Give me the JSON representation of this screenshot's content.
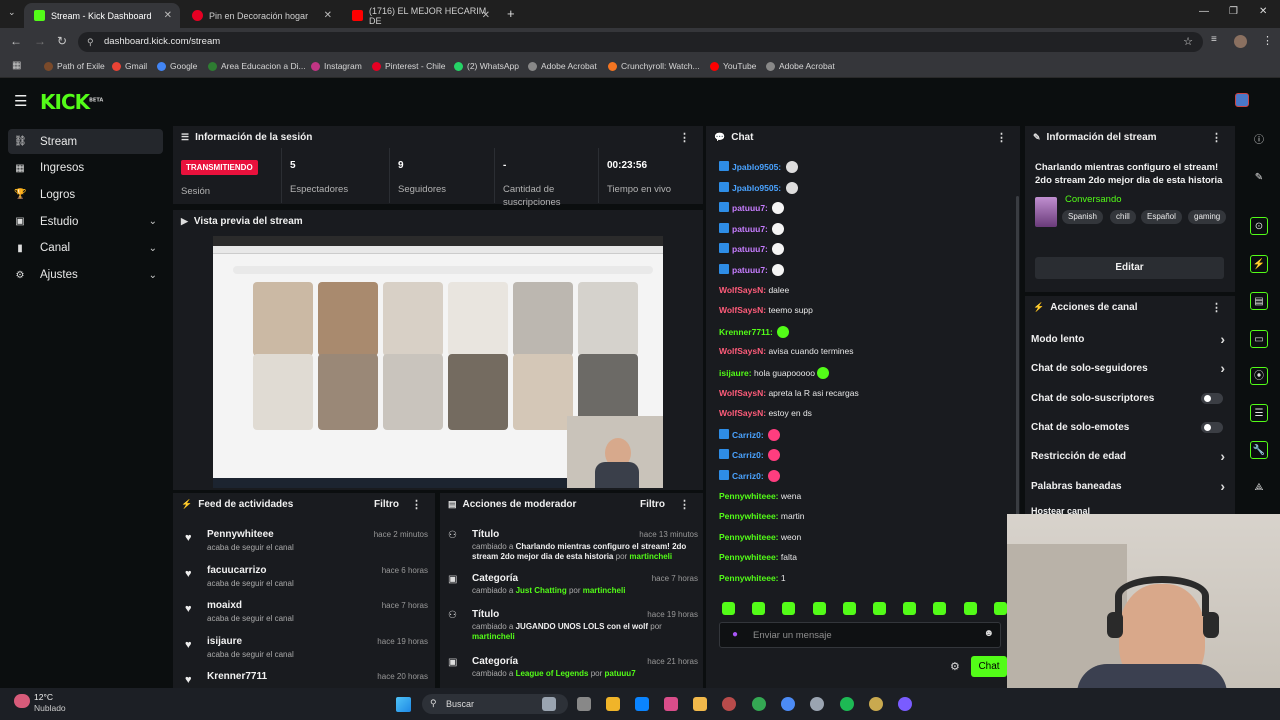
{
  "browser": {
    "tabs": [
      {
        "title": "Stream - Kick Dashboard",
        "color": "#53fc18"
      },
      {
        "title": "Pin en Decoración hogar",
        "color": "#e60023"
      },
      {
        "title": "(1716) EL MEJOR HECARIM DE",
        "color": "#ff0000"
      }
    ],
    "url": "dashboard.kick.com/stream",
    "bookmarks": [
      {
        "label": "Path of Exile",
        "color": "#7a4a2a"
      },
      {
        "label": "Gmail",
        "color": "#ea4335"
      },
      {
        "label": "Google",
        "color": "#4285f4"
      },
      {
        "label": "Area Educacion a Di...",
        "color": "#2e7d32"
      },
      {
        "label": "Instagram",
        "color": "#c13584"
      },
      {
        "label": "Pinterest - Chile",
        "color": "#e60023"
      },
      {
        "label": "(2) WhatsApp",
        "color": "#25d366"
      },
      {
        "label": "Adobe Acrobat",
        "color": "#888888"
      },
      {
        "label": "Crunchyroll: Watch...",
        "color": "#f47521"
      },
      {
        "label": "YouTube",
        "color": "#ff0000"
      },
      {
        "label": "Adobe Acrobat",
        "color": "#888888"
      }
    ]
  },
  "kick": {
    "logo": "KICK",
    "logo_sup": "BETA"
  },
  "sidebar": {
    "items": [
      {
        "label": "Stream",
        "icon": "link-icon",
        "glyph": "⛓",
        "active": true,
        "chevron": false
      },
      {
        "label": "Ingresos",
        "icon": "chart-icon",
        "glyph": "▦",
        "active": false,
        "chevron": false
      },
      {
        "label": "Logros",
        "icon": "trophy-icon",
        "glyph": "🏆",
        "active": false,
        "chevron": false
      },
      {
        "label": "Estudio",
        "icon": "studio-icon",
        "glyph": "▣",
        "active": false,
        "chevron": true
      },
      {
        "label": "Canal",
        "icon": "channel-icon",
        "glyph": "▮",
        "active": false,
        "chevron": true
      },
      {
        "label": "Ajustes",
        "icon": "gear-icon",
        "glyph": "⚙",
        "active": false,
        "chevron": true
      }
    ]
  },
  "session": {
    "title": "Información de la sesión",
    "badge": "TRANSMITIENDO",
    "session_label": "Sesión",
    "stats": [
      {
        "value": "5",
        "label": "Espectadores"
      },
      {
        "value": "9",
        "label": "Seguidores"
      },
      {
        "value": "-",
        "label": "Cantidad de suscripciones"
      },
      {
        "value": "00:23:56",
        "label": "Tiempo en vivo"
      }
    ]
  },
  "preview": {
    "title": "Vista previa del stream"
  },
  "feed": {
    "title": "Feed de actividades",
    "filter": "Filtro",
    "items": [
      {
        "name": "Pennywhiteee",
        "desc": "acaba de seguir el canal",
        "time": "hace 2 minutos"
      },
      {
        "name": "facuucarrizo",
        "desc": "acaba de seguir el canal",
        "time": "hace 6 horas"
      },
      {
        "name": "moaixd",
        "desc": "acaba de seguir el canal",
        "time": "hace 7 horas"
      },
      {
        "name": "isijaure",
        "desc": "acaba de seguir el canal",
        "time": "hace 19 horas"
      },
      {
        "name": "Krenner7711",
        "desc": "",
        "time": "hace 20 horas"
      }
    ]
  },
  "mod": {
    "title": "Acciones de moderador",
    "filter": "Filtro",
    "items": [
      {
        "type": "Título",
        "prefix": "cambiado a",
        "value": "Charlando mientras configuro el stream! 2do stream 2do mejor dia de esta historia",
        "by_label": "por",
        "by": "martincheli",
        "time": "hace 13 minutos"
      },
      {
        "type": "Categoría",
        "prefix": "cambiado a",
        "value": "Just Chatting",
        "by_label": "por",
        "by": "martincheli",
        "time": "hace 7 horas"
      },
      {
        "type": "Título",
        "prefix": "cambiado a",
        "value": "JUGANDO UNOS LOLS con el wolf",
        "by_label": "por",
        "by": "martincheli",
        "time": "hace 19 horas"
      },
      {
        "type": "Categoría",
        "prefix": "cambiado a",
        "value": "League of Legends",
        "by_label": "por",
        "by": "patuuu7",
        "time": "hace 21 horas"
      }
    ]
  },
  "chat": {
    "title": "Chat",
    "placeholder": "Enviar un mensaje",
    "send": "Chat",
    "messages": [
      {
        "user": "Jpablo9505:",
        "text": "",
        "color": "#4aa3ff",
        "badge": true,
        "emote": "#dddddd"
      },
      {
        "user": "Jpablo9505:",
        "text": "",
        "color": "#4aa3ff",
        "badge": true,
        "emote": "#dddddd"
      },
      {
        "user": "patuuu7:",
        "text": "",
        "color": "#c77dff",
        "badge": true,
        "emote": "#f5f5f5"
      },
      {
        "user": "patuuu7:",
        "text": "",
        "color": "#c77dff",
        "badge": true,
        "emote": "#f5f5f5"
      },
      {
        "user": "patuuu7:",
        "text": "",
        "color": "#c77dff",
        "badge": true,
        "emote": "#f5f5f5"
      },
      {
        "user": "patuuu7:",
        "text": "",
        "color": "#c77dff",
        "badge": true,
        "emote": "#f5f5f5"
      },
      {
        "user": "WolfSaysN:",
        "text": "dalee",
        "color": "#ff5c7a",
        "badge": false,
        "emote": ""
      },
      {
        "user": "WolfSaysN:",
        "text": "teemo supp",
        "color": "#ff5c7a",
        "badge": false,
        "emote": ""
      },
      {
        "user": "Krenner7711:",
        "text": "",
        "color": "#53fc18",
        "badge": false,
        "emote": "#53fc18"
      },
      {
        "user": "WolfSaysN:",
        "text": "avisa cuando termines",
        "color": "#ff5c7a",
        "badge": false,
        "emote": ""
      },
      {
        "user": "isijaure:",
        "text": "hola guapooooo",
        "color": "#53fc18",
        "badge": false,
        "emote": "#53fc18"
      },
      {
        "user": "WolfSaysN:",
        "text": "apreta la R asi recargas",
        "color": "#ff5c7a",
        "badge": false,
        "emote": ""
      },
      {
        "user": "WolfSaysN:",
        "text": "estoy en ds",
        "color": "#ff5c7a",
        "badge": false,
        "emote": ""
      },
      {
        "user": "Carriz0:",
        "text": "",
        "color": "#4aa3ff",
        "badge": true,
        "emote": "#ff3d7f"
      },
      {
        "user": "Carriz0:",
        "text": "",
        "color": "#4aa3ff",
        "badge": true,
        "emote": "#ff3d7f"
      },
      {
        "user": "Carriz0:",
        "text": "",
        "color": "#4aa3ff",
        "badge": true,
        "emote": "#ff3d7f"
      },
      {
        "user": "Pennywhiteee:",
        "text": "wena",
        "color": "#53fc18",
        "badge": false,
        "emote": ""
      },
      {
        "user": "Pennywhiteee:",
        "text": "martin",
        "color": "#53fc18",
        "badge": false,
        "emote": ""
      },
      {
        "user": "Pennywhiteee:",
        "text": "weon",
        "color": "#53fc18",
        "badge": false,
        "emote": ""
      },
      {
        "user": "Pennywhiteee:",
        "text": "falta",
        "color": "#53fc18",
        "badge": false,
        "emote": ""
      },
      {
        "user": "Pennywhiteee:",
        "text": "1",
        "color": "#53fc18",
        "badge": false,
        "emote": ""
      }
    ]
  },
  "stream_info": {
    "title": "Información del stream",
    "stream_title": "Charlando mientras configuro el stream! 2do stream 2do mejor dia de esta historia",
    "category": "Conversando",
    "tags": [
      "Spanish",
      "chill",
      "Español",
      "gaming"
    ],
    "edit": "Editar"
  },
  "channel_actions": {
    "title": "Acciones de canal",
    "items": [
      {
        "label": "Modo lento",
        "control": "chevron"
      },
      {
        "label": "Chat de solo-seguidores",
        "control": "chevron"
      },
      {
        "label": "Chat de solo-suscriptores",
        "control": "toggle"
      },
      {
        "label": "Chat de solo-emotes",
        "control": "toggle"
      },
      {
        "label": "Restricción de edad",
        "control": "chevron"
      },
      {
        "label": "Palabras baneadas",
        "control": "chevron"
      },
      {
        "label": "Hostear canal",
        "control": "none"
      }
    ]
  },
  "taskbar": {
    "temp": "12°C",
    "weather": "Nublado",
    "search": "Buscar"
  }
}
